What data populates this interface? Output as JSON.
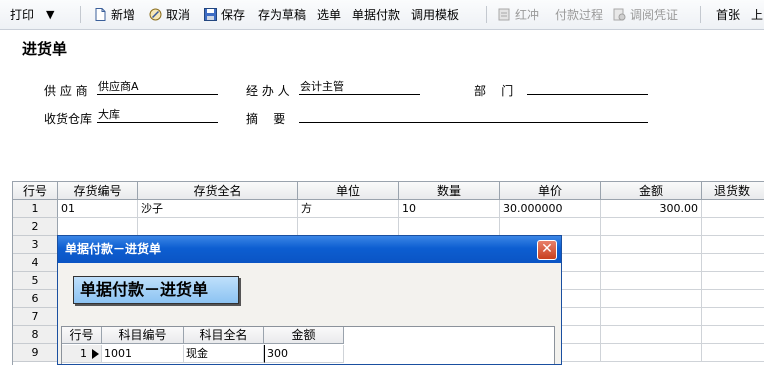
{
  "toolbar": {
    "print": "打印",
    "print_menu": "▼",
    "new": "新增",
    "cancel": "取消",
    "save": "保存",
    "save_draft": "存为草稿",
    "select_doc": "选单",
    "doc_payment": "单据付款",
    "use_template": "调用模板",
    "red_flush": "红冲",
    "payment_process": "付款过程",
    "view_voucher": "调阅凭证",
    "first_page": "首张",
    "prev_page": "上"
  },
  "form": {
    "title": "进货单",
    "supplier_label": "供 应 商",
    "supplier_value": "供应商A",
    "handler_label": "经 办 人",
    "handler_value": "会计主管",
    "dept_label": "部    门",
    "dept_value": "",
    "warehouse_label": "收货仓库",
    "warehouse_value": "大库",
    "summary_label": "摘    要",
    "summary_value": ""
  },
  "grid": {
    "headers": [
      "行号",
      "存货编号",
      "存货全名",
      "单位",
      "数量",
      "单价",
      "金额",
      "退货数"
    ],
    "row_numbers": [
      "1",
      "2",
      "3",
      "4",
      "5",
      "6",
      "7",
      "8",
      "9"
    ],
    "rows": [
      [
        "01",
        "沙子",
        "方",
        "10",
        "30.000000",
        "300.00",
        ""
      ]
    ]
  },
  "dialog": {
    "title": "单据付款－进货单",
    "close": "✕",
    "banner": "单据付款－进货单",
    "headers": [
      "行号",
      "科目编号",
      "科目全名",
      "金额"
    ],
    "row": {
      "num": "1",
      "code": "1001",
      "name": "现金",
      "amount": "300"
    }
  }
}
